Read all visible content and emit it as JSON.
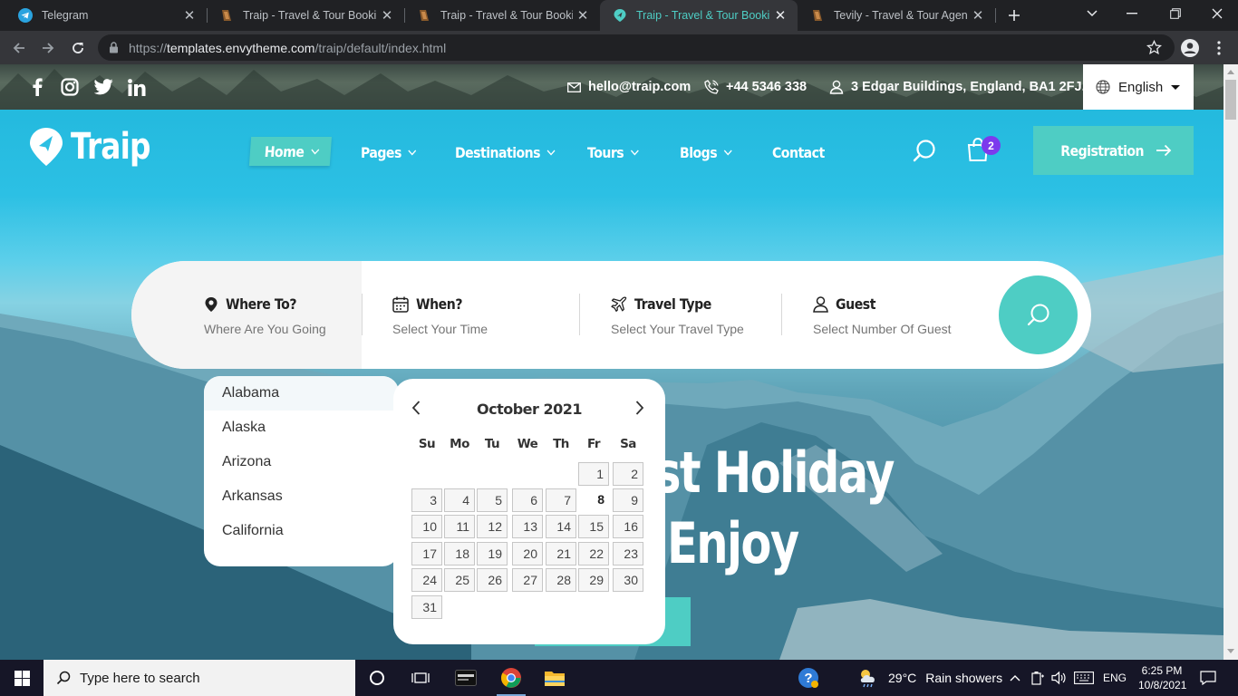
{
  "browser": {
    "tabs": [
      {
        "title": "Telegram",
        "icon": "telegram-icon"
      },
      {
        "title": "Traip - Travel & Tour Booking",
        "icon": "envytheme-icon"
      },
      {
        "title": "Traip - Travel & Tour Booking",
        "icon": "envytheme-icon"
      },
      {
        "title": "Traip - Travel & Tour Booking",
        "icon": "traip-icon",
        "active": true
      },
      {
        "title": "Tevily - Travel & Tour Agency",
        "icon": "envytheme-icon"
      }
    ],
    "url_prefix": "https://",
    "url_host": "templates.envytheme.com",
    "url_path": "/traip/default/index.html"
  },
  "topbar": {
    "email": "hello@traip.com",
    "phone": "+44 5346 338",
    "address": "3 Edgar Buildings, England, BA1 2FJ.",
    "language": "English"
  },
  "header": {
    "logo": "Traip",
    "nav": [
      "Home",
      "Pages",
      "Destinations",
      "Tours",
      "Blogs",
      "Contact"
    ],
    "cart_count": "2",
    "register": "Registration"
  },
  "search": {
    "fields": [
      {
        "label": "Where To?",
        "placeholder": "Where Are You Going"
      },
      {
        "label": "When?",
        "placeholder": "Select Your Time"
      },
      {
        "label": "Travel Type",
        "placeholder": "Select Your Travel Type"
      },
      {
        "label": "Guest",
        "placeholder": "Select Number Of Guest"
      }
    ]
  },
  "destinations": [
    "Alabama",
    "Alaska",
    "Arizona",
    "Arkansas",
    "California"
  ],
  "calendar": {
    "title": "October 2021",
    "weekdays": [
      "Su",
      "Mo",
      "Tu",
      "We",
      "Th",
      "Fr",
      "Sa"
    ],
    "first_weekday": 5,
    "days": 31,
    "today": 8
  },
  "hero": {
    "line1_visible": "st Holiday",
    "line2_visible": "Enjoy"
  },
  "taskbar": {
    "search_placeholder": "Type here to search",
    "temp": "29°C",
    "weather": "Rain showers",
    "lang": "ENG",
    "time": "6:25 PM",
    "date": "10/8/2021"
  },
  "colors": {
    "accent": "#4ecdc4",
    "badge": "#7c3aed",
    "sky": "#2cc0e4"
  }
}
